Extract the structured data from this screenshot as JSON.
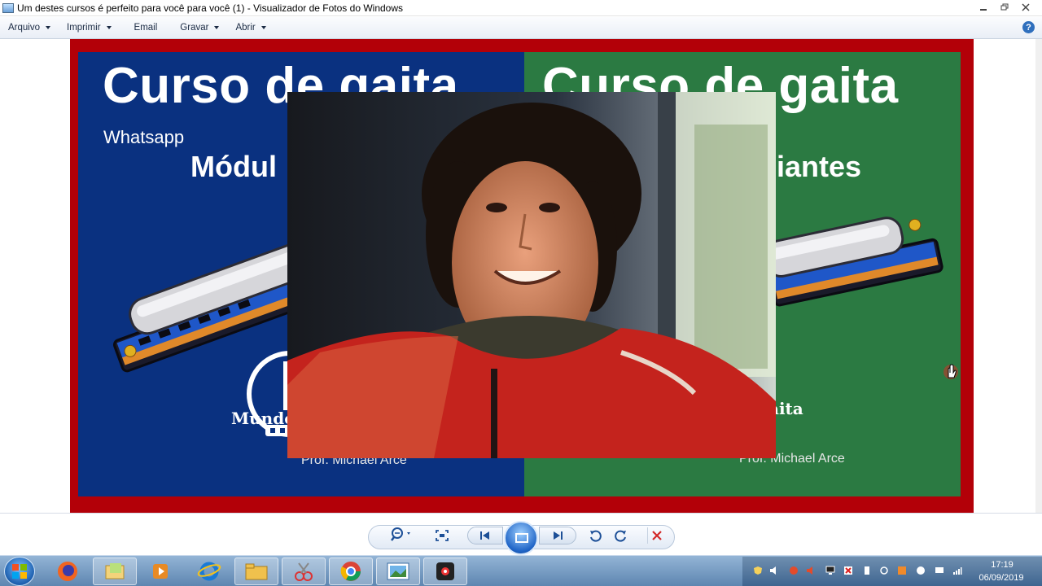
{
  "window": {
    "title": "Um destes cursos é perfeito para você para você (1) - Visualizador de Fotos do Windows"
  },
  "menu": {
    "items": [
      "Arquivo",
      "Imprimir",
      "Email",
      "Gravar",
      "Abrir"
    ],
    "help_label": "?"
  },
  "photo": {
    "left_panel": {
      "title": "Curso de gaita",
      "label": "Whatsapp",
      "subtitle": "Módul",
      "logo_text": "Mundo",
      "teacher": "Prof. Michael Arce"
    },
    "right_panel": {
      "title": "Curso de gaita",
      "subtitle": "ciantes",
      "logo_text": "aita",
      "teacher": "Prof. Michael Arce"
    },
    "colors": {
      "frame": "#b30008",
      "left_bg": "#0a3180",
      "right_bg": "#2b7a42"
    }
  },
  "controls": {
    "zoom_icon": "magnifier-icon",
    "fit_icon": "actual-size-icon",
    "prev_icon": "previous-icon",
    "slideshow_icon": "slideshow-icon",
    "next_icon": "next-icon",
    "rotate_ccw_icon": "rotate-left-icon",
    "rotate_cw_icon": "rotate-right-icon",
    "delete_icon": "delete-icon"
  },
  "taskbar": {
    "apps": [
      "firefox-icon",
      "explorer-icon",
      "media-player-icon",
      "internet-explorer-icon",
      "folder-icon",
      "snipping-tool-icon",
      "chrome-icon",
      "photo-viewer-icon",
      "recorder-icon"
    ],
    "clock_time": "17:19",
    "clock_date": "06/09/2019"
  }
}
